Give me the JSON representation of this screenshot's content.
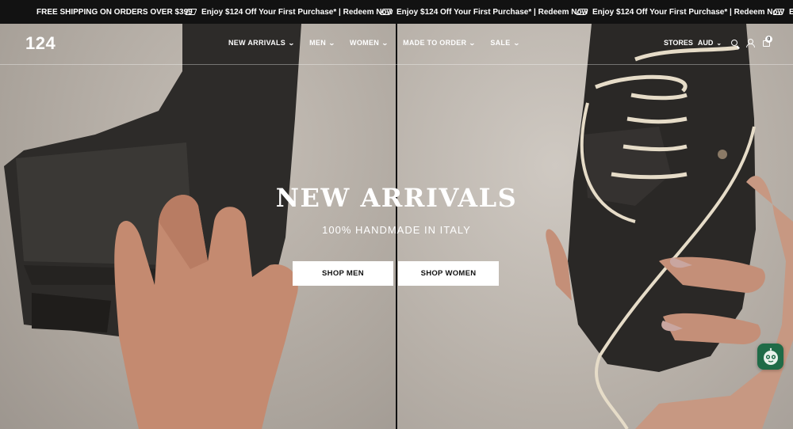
{
  "announcement": {
    "messages": [
      "FREE SHIPPING ON ORDERS OVER $399",
      "Enjoy $124 Off Your First Purchase* | Redeem Now",
      "Enjoy $124 Off Your First Purchase* | Redeem Now",
      "Enjoy $124 Off Your First Purchase* | Redeem Now",
      "En"
    ]
  },
  "header": {
    "logo": "124",
    "nav": [
      "NEW ARRIVALS",
      "MEN",
      "WOMEN",
      "MADE TO ORDER",
      "SALE"
    ],
    "stores_label": "STORES",
    "currency": "AUD",
    "cart_count": "0"
  },
  "hero": {
    "title": "NEW ARRIVALS",
    "subtitle": "100% HANDMADE IN ITALY",
    "button_men": "SHOP MEN",
    "button_women": "SHOP WOMEN"
  },
  "icons": {
    "search": "search-icon",
    "account": "user-icon",
    "cart": "bag-icon",
    "chat": "chat-bot-icon",
    "promo": "tag-icon"
  }
}
